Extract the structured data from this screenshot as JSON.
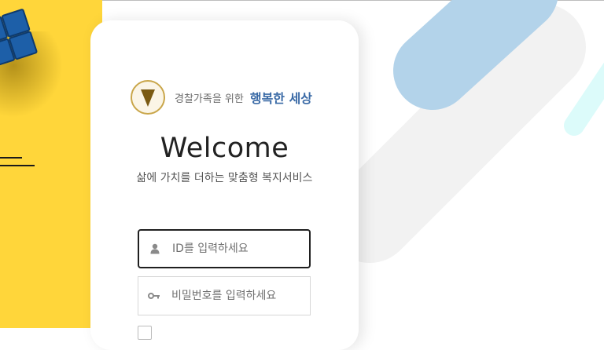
{
  "brand": {
    "tagline": "경찰가족을 위한",
    "name": "행복한 세상",
    "emblem_icon": "police-emblem-icon"
  },
  "welcome": {
    "title": "Welcome",
    "subtitle": "삶에 가치를 더하는 맞춤형 복지서비스"
  },
  "login": {
    "id_placeholder": "ID를 입력하세요",
    "password_placeholder": "비밀번호를 입력하세요",
    "id_icon": "user-icon",
    "password_icon": "key-icon"
  },
  "colors": {
    "yellow_panel": "#ffd63a",
    "brand_blue": "#3a6aa6",
    "deco_blue": "#b3d3ea",
    "deco_gray": "#f2f2f2",
    "deco_cyan": "#dcfbfa"
  }
}
